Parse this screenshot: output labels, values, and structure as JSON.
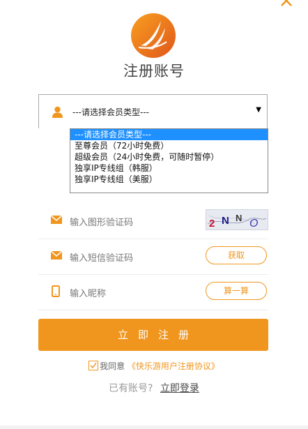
{
  "header": {
    "title": "注册账号"
  },
  "member_select": {
    "value": "---请选择会员类型---",
    "options": [
      "---请选择会员类型---",
      "至尊会员（72小时免费）",
      "超级会员（24小时免费，可随时暂停）",
      "独享IP专线组（韩服）",
      "独享IP专线组（美服）"
    ]
  },
  "fields": {
    "captcha_placeholder": "输入图形验证码",
    "captcha_text": "2NNO",
    "sms_placeholder": "输入短信验证码",
    "sms_button": "获取",
    "nickname_placeholder": "输入昵称",
    "nickname_button": "算一算"
  },
  "submit": {
    "label": "立即注册"
  },
  "agreement": {
    "prefix": "我同意",
    "link": "《快乐游用户注册协议》"
  },
  "login": {
    "prompt": "已有账号?",
    "link": "立即登录"
  },
  "colors": {
    "accent": "#f0961e",
    "selected_option": "#1e90ff"
  },
  "icons": [
    "close-icon",
    "logo-icon",
    "user-icon",
    "mail-icon",
    "phone-icon",
    "check-icon",
    "dropdown-caret-icon"
  ]
}
